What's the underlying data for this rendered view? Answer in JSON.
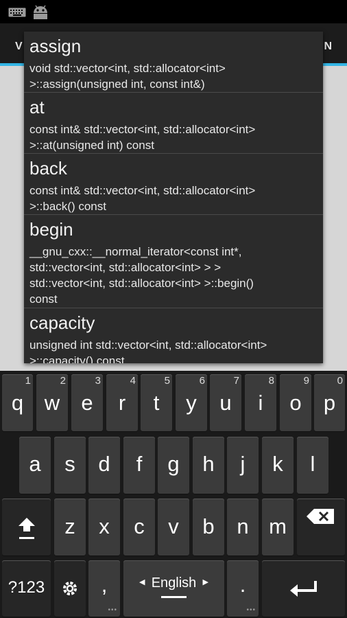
{
  "status_bar": {
    "icons": [
      "keyboard-icon",
      "android-icon"
    ]
  },
  "action_bar": {
    "left_fragment": "V",
    "right_fragment": "N"
  },
  "autocomplete": {
    "items": [
      {
        "name": "assign",
        "signature": "void std::vector<int, std::allocator<int>\n>::assign(unsigned int, const int&)"
      },
      {
        "name": "at",
        "signature": "const int& std::vector<int, std::allocator<int>\n>::at(unsigned int) const"
      },
      {
        "name": "back",
        "signature": "const int& std::vector<int, std::allocator<int>\n>::back() const"
      },
      {
        "name": "begin",
        "signature": "__gnu_cxx::__normal_iterator<const int*,\nstd::vector<int, std::allocator<int> > >\nstd::vector<int, std::allocator<int> >::begin()\nconst"
      },
      {
        "name": "capacity",
        "signature": "unsigned int std::vector<int, std::allocator<int>\n>::capacity() const"
      }
    ]
  },
  "keyboard": {
    "row1": [
      {
        "label": "q",
        "hint": "1"
      },
      {
        "label": "w",
        "hint": "2"
      },
      {
        "label": "e",
        "hint": "3"
      },
      {
        "label": "r",
        "hint": "4"
      },
      {
        "label": "t",
        "hint": "5"
      },
      {
        "label": "y",
        "hint": "6"
      },
      {
        "label": "u",
        "hint": "7"
      },
      {
        "label": "i",
        "hint": "8"
      },
      {
        "label": "o",
        "hint": "9"
      },
      {
        "label": "p",
        "hint": "0"
      }
    ],
    "row2": [
      "a",
      "s",
      "d",
      "f",
      "g",
      "h",
      "j",
      "k",
      "l"
    ],
    "row3": [
      "z",
      "x",
      "c",
      "v",
      "b",
      "n",
      "m"
    ],
    "symbols_label": "?123",
    "comma_label": ",",
    "space_label": "English",
    "period_label": ".",
    "shift_icon": "shift-icon",
    "delete_icon": "backspace-icon",
    "settings_icon": "settings-icon",
    "enter_icon": "enter-icon",
    "colors": {
      "key": "#3b3b3b",
      "key_dark": "#262626",
      "accent": "#33b5e5"
    }
  }
}
